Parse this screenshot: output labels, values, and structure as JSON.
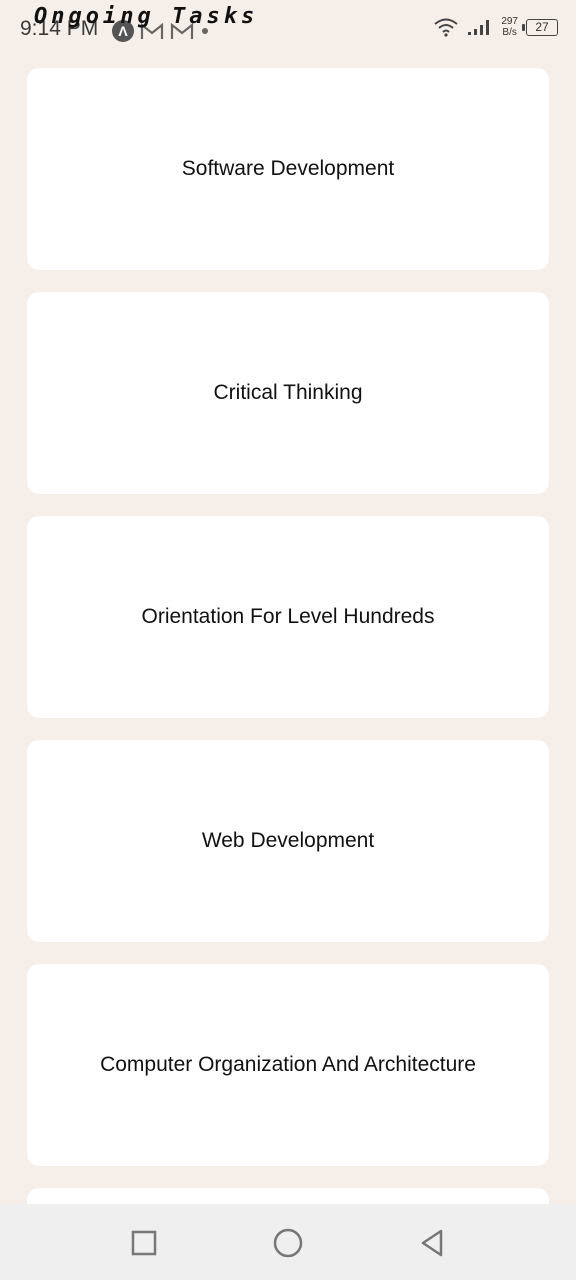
{
  "status_bar": {
    "time": "9:14 PM",
    "net_speed_value": "297",
    "net_speed_unit": "B/s",
    "battery": "27",
    "notifications": [
      "a-icon",
      "gmail-icon",
      "gmail-icon",
      "dot-icon"
    ],
    "system_icons": [
      "wifi-icon",
      "signal-icon"
    ]
  },
  "header": {
    "title": "Ongoing Tasks"
  },
  "tasks": [
    {
      "label": "Software Development"
    },
    {
      "label": "Critical Thinking"
    },
    {
      "label": "Orientation For Level Hundreds"
    },
    {
      "label": "Web Development"
    },
    {
      "label": "Computer Organization And Architecture"
    }
  ],
  "nav_bar": {
    "buttons": [
      "recents-square-icon",
      "home-circle-icon",
      "back-triangle-icon"
    ]
  },
  "colors": {
    "background": "#f6efe9",
    "card": "#ffffff",
    "nav_bar": "#efefef"
  }
}
